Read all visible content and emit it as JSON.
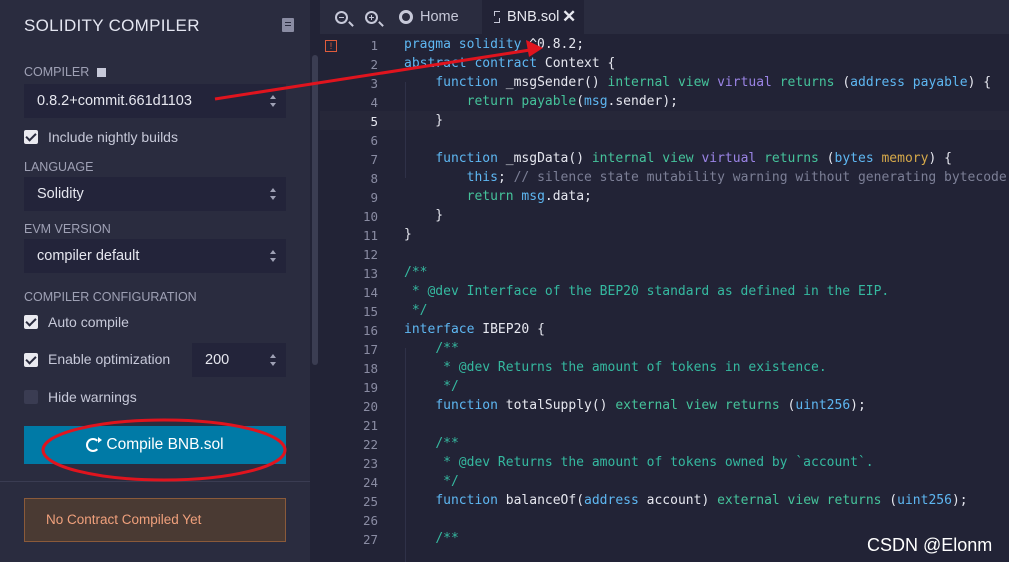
{
  "compiler_panel": {
    "title": "SOLIDITY COMPILER",
    "compiler_label": "COMPILER",
    "compiler_version": "0.8.2+commit.661d1103",
    "include_nightly_label": "Include nightly builds",
    "language_label": "LANGUAGE",
    "language_value": "Solidity",
    "evm_label": "EVM VERSION",
    "evm_value": "compiler default",
    "config_label": "COMPILER CONFIGURATION",
    "auto_compile_label": "Auto compile",
    "optimization_label": "Enable optimization",
    "optimization_runs": "200",
    "hide_warnings_label": "Hide warnings",
    "compile_button": "Compile BNB.sol",
    "status_message": "No Contract Compiled Yet"
  },
  "editor": {
    "tabs": {
      "home": "Home",
      "file": "BNB.sol"
    },
    "line_numbers": [
      "1",
      "2",
      "3",
      "4",
      "5",
      "6",
      "7",
      "8",
      "9",
      "10",
      "11",
      "12",
      "13",
      "14",
      "15",
      "16",
      "17",
      "18",
      "19",
      "20",
      "21",
      "22",
      "23",
      "24",
      "25",
      "26",
      "27"
    ]
  },
  "watermark": "CSDN @Elonm",
  "colors": {
    "accent": "#007aa6",
    "annotation": "#e0141e"
  }
}
